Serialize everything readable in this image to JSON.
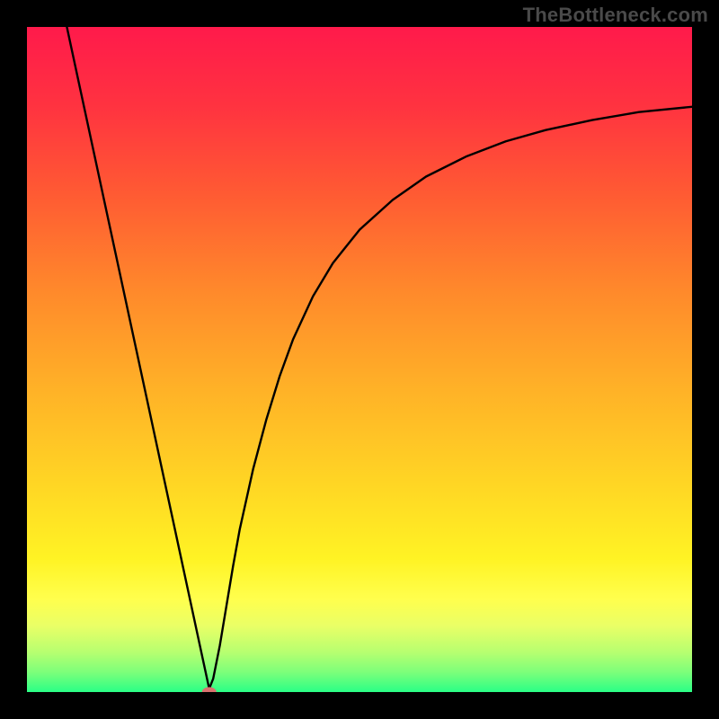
{
  "watermark": "TheBottleneck.com",
  "chart_data": {
    "type": "line",
    "title": "",
    "xlabel": "",
    "ylabel": "",
    "xlim": [
      0,
      100
    ],
    "ylim": [
      0,
      100
    ],
    "grid": false,
    "legend": false,
    "background": {
      "type": "vertical-gradient",
      "stops": [
        {
          "pos": 0.0,
          "color": "#ff1a4b"
        },
        {
          "pos": 0.12,
          "color": "#ff3340"
        },
        {
          "pos": 0.25,
          "color": "#ff5a33"
        },
        {
          "pos": 0.4,
          "color": "#ff8a2b"
        },
        {
          "pos": 0.55,
          "color": "#ffb327"
        },
        {
          "pos": 0.7,
          "color": "#ffd924"
        },
        {
          "pos": 0.8,
          "color": "#fff324"
        },
        {
          "pos": 0.86,
          "color": "#ffff4d"
        },
        {
          "pos": 0.9,
          "color": "#eaff66"
        },
        {
          "pos": 0.94,
          "color": "#b7ff70"
        },
        {
          "pos": 0.97,
          "color": "#7dff7a"
        },
        {
          "pos": 1.0,
          "color": "#2aff86"
        }
      ]
    },
    "series": [
      {
        "name": "left-branch",
        "x": [
          6.0,
          8.0,
          10.0,
          12.0,
          14.0,
          16.0,
          18.0,
          20.0,
          22.0,
          24.0,
          26.0,
          27.4
        ],
        "y": [
          100.0,
          90.7,
          81.4,
          72.1,
          62.8,
          53.5,
          44.2,
          34.9,
          25.6,
          16.3,
          7.0,
          0.5
        ]
      },
      {
        "name": "right-branch",
        "x": [
          27.4,
          28.0,
          29.0,
          30.0,
          31.0,
          32.0,
          34.0,
          36.0,
          38.0,
          40.0,
          43.0,
          46.0,
          50.0,
          55.0,
          60.0,
          66.0,
          72.0,
          78.0,
          85.0,
          92.0,
          100.0
        ],
        "y": [
          0.5,
          2.0,
          7.0,
          13.0,
          19.0,
          24.5,
          33.5,
          41.0,
          47.5,
          53.0,
          59.5,
          64.5,
          69.5,
          74.0,
          77.5,
          80.5,
          82.8,
          84.5,
          86.0,
          87.2,
          88.0
        ]
      }
    ],
    "marker": {
      "name": "minimum-marker",
      "x": 27.4,
      "y": 0.0,
      "color": "#d9716e"
    }
  }
}
